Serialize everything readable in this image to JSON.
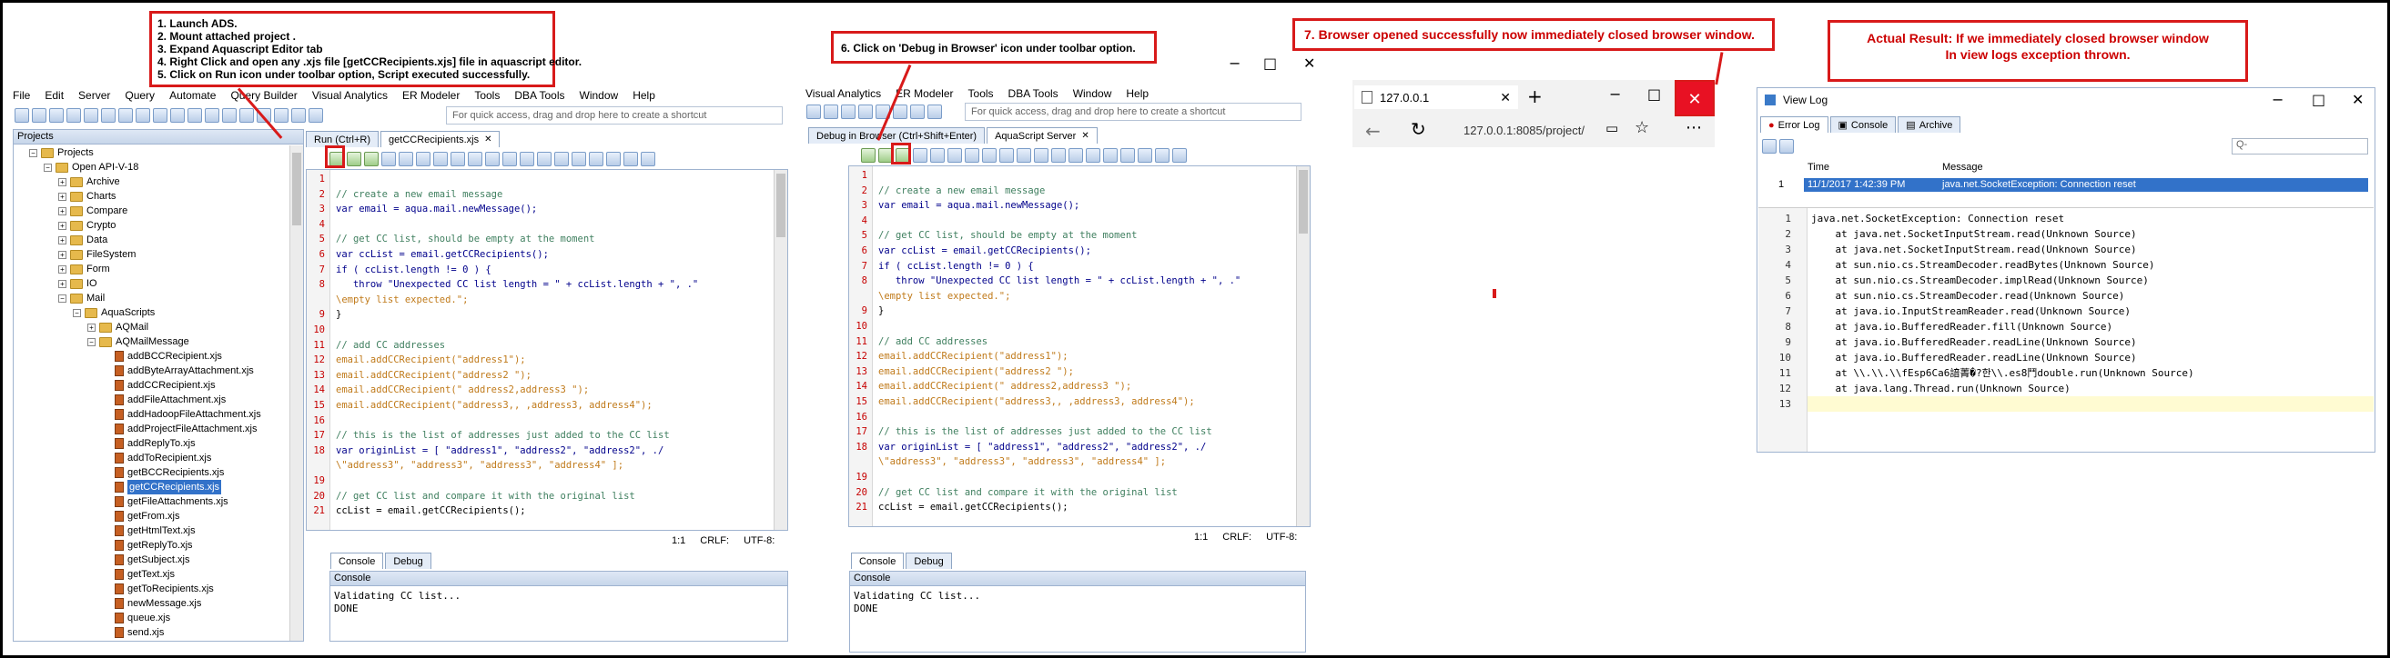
{
  "steps_note": {
    "lines": [
      "1. Launch ADS.",
      "2. Mount attached project .",
      "3. Expand Aquascript Editor tab",
      "4. Right Click and open any .xjs file [getCCRecipients.xjs] file in aquascript editor.",
      "5. Click on Run icon under toolbar option, Script executed successfully."
    ]
  },
  "step6_note": "6. Click on 'Debug in Browser' icon under toolbar option.",
  "step7_note": "7. Browser opened successfully now immediately closed browser window.",
  "actual_note": {
    "line1": "Actual Result: If we immediately closed browser window",
    "line2": "In view logs exception thrown."
  },
  "ads_left": {
    "menu": [
      "File",
      "Edit",
      "Server",
      "Query",
      "Automate",
      "Query Builder",
      "Visual Analytics",
      "ER Modeler",
      "Tools",
      "DBA Tools",
      "Window",
      "Help"
    ],
    "quick_access": "For quick access, drag and drop here to create a shortcut",
    "projects_title": "Projects",
    "tree": {
      "root": "Projects",
      "project": "Open API-V-18",
      "folders": [
        "Archive",
        "Charts",
        "Compare",
        "Crypto",
        "Data",
        "FileSystem",
        "Form",
        "IO",
        "Mail"
      ],
      "aquascripts": "AquaScripts",
      "aqmail": "AQMail",
      "aqmailmessage": "AQMailMessage",
      "files": [
        "addBCCRecipient.xjs",
        "addByteArrayAttachment.xjs",
        "addCCRecipient.xjs",
        "addFileAttachment.xjs",
        "addHadoopFileAttachment.xjs",
        "addProjectFileAttachment.xjs",
        "addReplyTo.xjs",
        "addToRecipient.xjs",
        "getBCCRecipients.xjs",
        "getCCRecipients.xjs",
        "getFileAttachments.xjs",
        "getFrom.xjs",
        "getHtmlText.xjs",
        "getReplyTo.xjs",
        "getSubject.xjs",
        "getText.xjs",
        "getToRecipients.xjs",
        "newMessage.xjs",
        "queue.xjs",
        "send.xjs"
      ],
      "selected_index": 9
    },
    "tabs": {
      "run_tooltip": "Run (Ctrl+R)",
      "file_tab": "getCCRecipients.xjs"
    },
    "status": {
      "pos": "1:1",
      "eol": "CRLF:",
      "enc": "UTF-8:"
    },
    "console_tab": "Console",
    "debug_tab": "Debug",
    "console_title": "Console",
    "console_lines": [
      "Validating CC list...",
      "DONE"
    ]
  },
  "code": {
    "line_numbers": [
      "1",
      "2",
      "3",
      "4",
      "5",
      "6",
      "7",
      "8",
      "",
      "9",
      "10",
      "11",
      "12",
      "13",
      "14",
      "15",
      "16",
      "17",
      "18",
      "",
      "19",
      "20",
      "21"
    ],
    "lines": [
      "",
      "// create a new email message",
      "var email = aqua.mail.newMessage();",
      "",
      "// get CC list, should be empty at the moment",
      "var ccList = email.getCCRecipients();",
      "if ( ccList.length != 0 ) {",
      "   throw \"Unexpected CC list length = \" + ccList.length + \", .\"",
      "\\empty list expected.\";",
      "}",
      "",
      "// add CC addresses",
      "email.addCCRecipient(\"address1\");",
      "email.addCCRecipient(\"address2 \");",
      "email.addCCRecipient(\" address2,address3 \");",
      "email.addCCRecipient(\"address3,, ,address3, address4\");",
      "",
      "// this is the list of addresses just added to the CC list",
      "var originList = [ \"address1\", \"address2\", \"address2\", ./",
      "\\\"address3\", \"address3\", \"address3\", \"address4\" ];",
      "",
      "// get CC list and compare it with the original list",
      "ccList = email.getCCRecipients();"
    ]
  },
  "ads_mid": {
    "menu": [
      "Visual Analytics",
      "ER Modeler",
      "Tools",
      "DBA Tools",
      "Window",
      "Help"
    ],
    "quick_access": "For quick access, drag and drop here to create a shortcut",
    "tabs": {
      "debug_tooltip": "Debug in Browser (Ctrl+Shift+Enter)",
      "server_tab": "AquaScript Server"
    },
    "status": {
      "pos": "1:1",
      "eol": "CRLF:",
      "enc": "UTF-8:"
    },
    "console_tab": "Console",
    "debug_tab": "Debug",
    "console_title": "Console",
    "console_lines": [
      "Validating CC list...",
      "DONE"
    ]
  },
  "browser": {
    "tab_title": "127.0.0.1",
    "new_tab": "+",
    "url": "127.0.0.1:8085/project/"
  },
  "viewlog": {
    "title": "View Log",
    "tabs": [
      "Error Log",
      "Console",
      "Archive"
    ],
    "filter_placeholder": "Q-",
    "col_time": "Time",
    "col_message": "Message",
    "row": {
      "num": "1",
      "time": "11/1/2017 1:42:39 PM",
      "message": "java.net.SocketException: Connection reset"
    },
    "trace_numbers": [
      "1",
      "2",
      "3",
      "4",
      "5",
      "6",
      "7",
      "8",
      "9",
      "10",
      "11",
      "12",
      "13"
    ],
    "trace": [
      "",
      "java.net.SocketException: Connection reset",
      "    at java.net.SocketInputStream.read(Unknown Source)",
      "    at java.net.SocketInputStream.read(Unknown Source)",
      "    at sun.nio.cs.StreamDecoder.readBytes(Unknown Source)",
      "    at sun.nio.cs.StreamDecoder.implRead(Unknown Source)",
      "    at sun.nio.cs.StreamDecoder.read(Unknown Source)",
      "    at java.io.InputStreamReader.read(Unknown Source)",
      "    at java.io.BufferedReader.fill(Unknown Source)",
      "    at java.io.BufferedReader.readLine(Unknown Source)",
      "    at java.io.BufferedReader.readLine(Unknown Source)",
      "    at \\\\.\\\\.\\\\fEsp6Ca6諳菁�?한\\\\.es8鬥double.run(Unknown Source)",
      "    at java.lang.Thread.run(Unknown Source)"
    ]
  },
  "colors": {
    "annotation_red": "#d81a1a",
    "selection_blue": "#3272c9",
    "comment_green": "#3f7f5f",
    "line_number_red": "#c60000"
  }
}
